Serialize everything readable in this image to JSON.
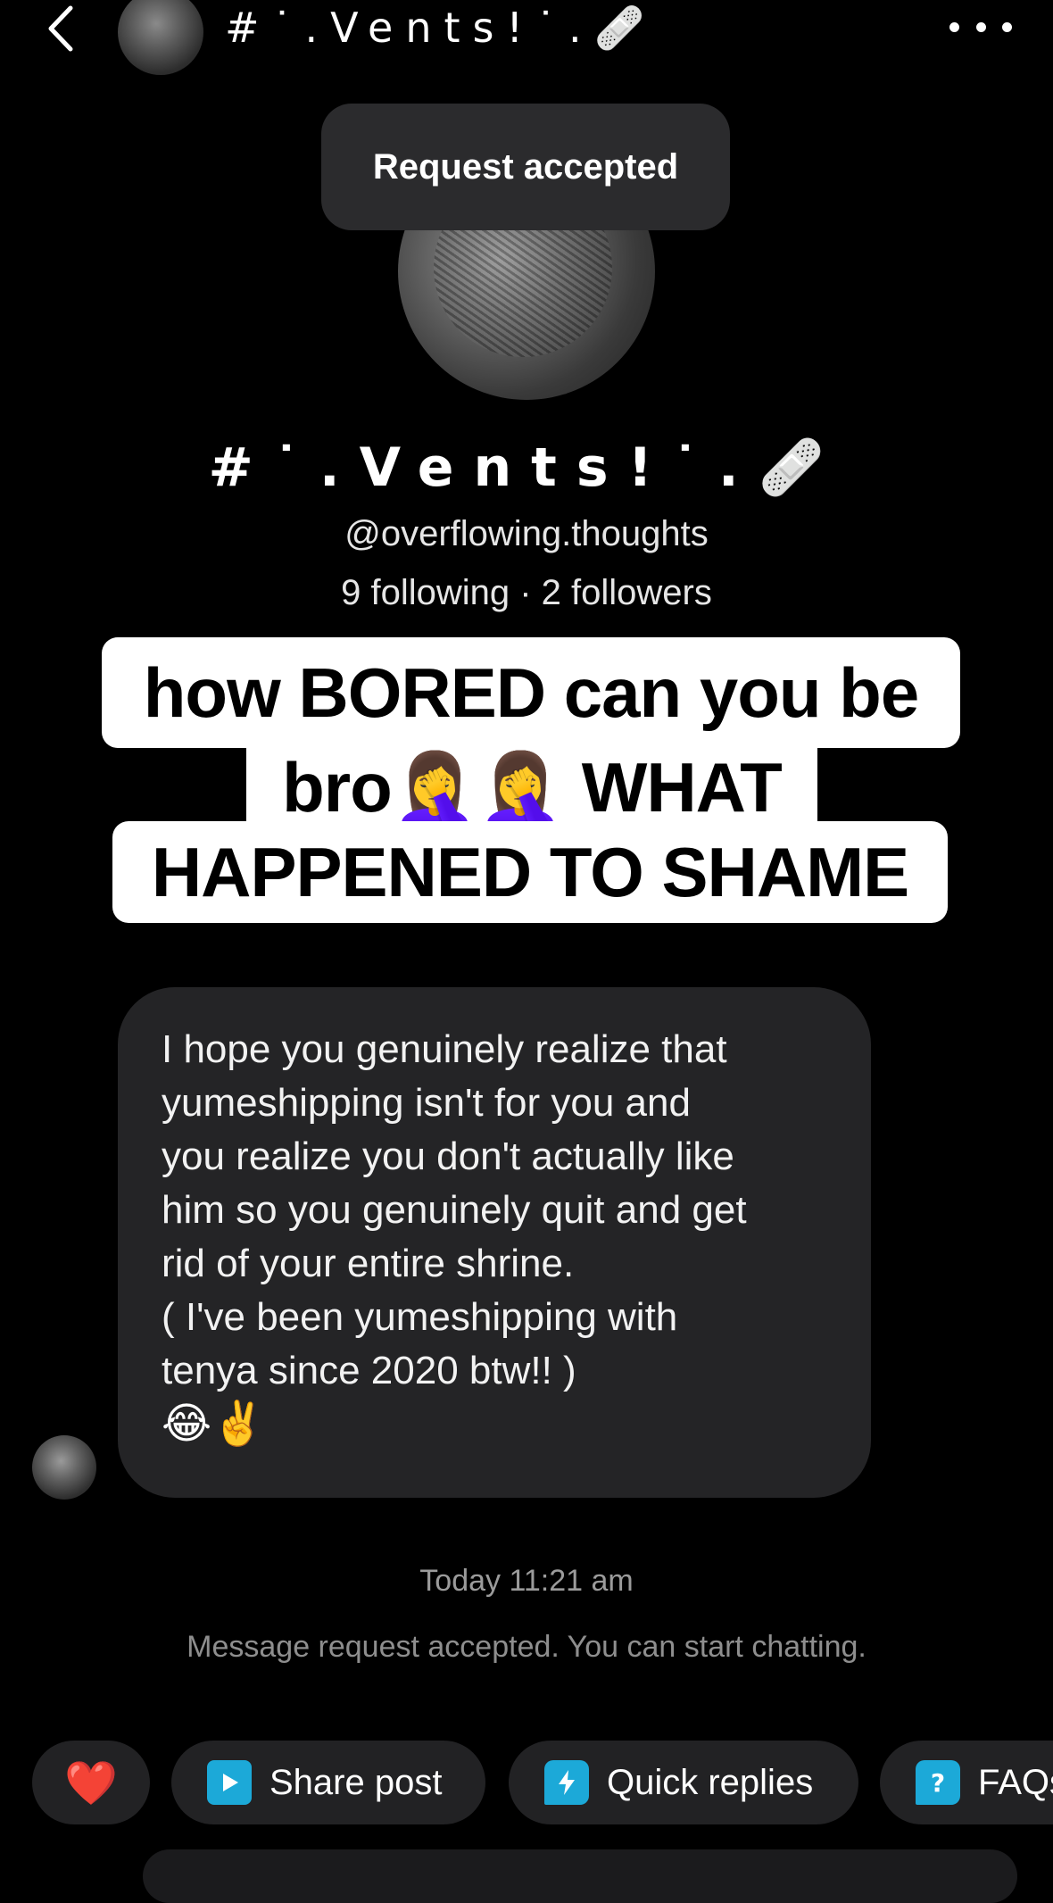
{
  "header": {
    "name": "#˙.Vents!˙.🩹",
    "back_icon": "chevron-left-icon",
    "more_icon": "more-horizontal-icon"
  },
  "toast": {
    "text": "Request accepted"
  },
  "profile": {
    "name": "#˙.Vents!˙.🩹",
    "handle": "@overflowing.thoughts",
    "stats": "9 following · 2 followers"
  },
  "caption": {
    "line1": "how BORED can you be",
    "line2": "bro🤦‍♀️🤦‍♀️ WHAT",
    "line3": "HAPPENED TO SHAME"
  },
  "message": {
    "text": "I hope you genuinely realize that\nyumeshipping isn't for you and\nyou realize you don't actually like\nhim so you genuinely quit and get\nrid of your entire shrine.\n( I've been yumeshipping with\ntenya since 2020 btw!! )",
    "emoji": "😂✌️"
  },
  "meta": {
    "timestamp": "Today 11:21 am",
    "system_note": "Message request accepted. You can start chatting."
  },
  "chips": {
    "heart": "❤️",
    "share_label": "Share post",
    "quick_label": "Quick replies",
    "faq_label": "FAQs"
  },
  "colors": {
    "background": "#000000",
    "bubble": "#242426",
    "chip": "#222224",
    "accent": "#1ca9d8",
    "toast": "#2b2b2d"
  }
}
